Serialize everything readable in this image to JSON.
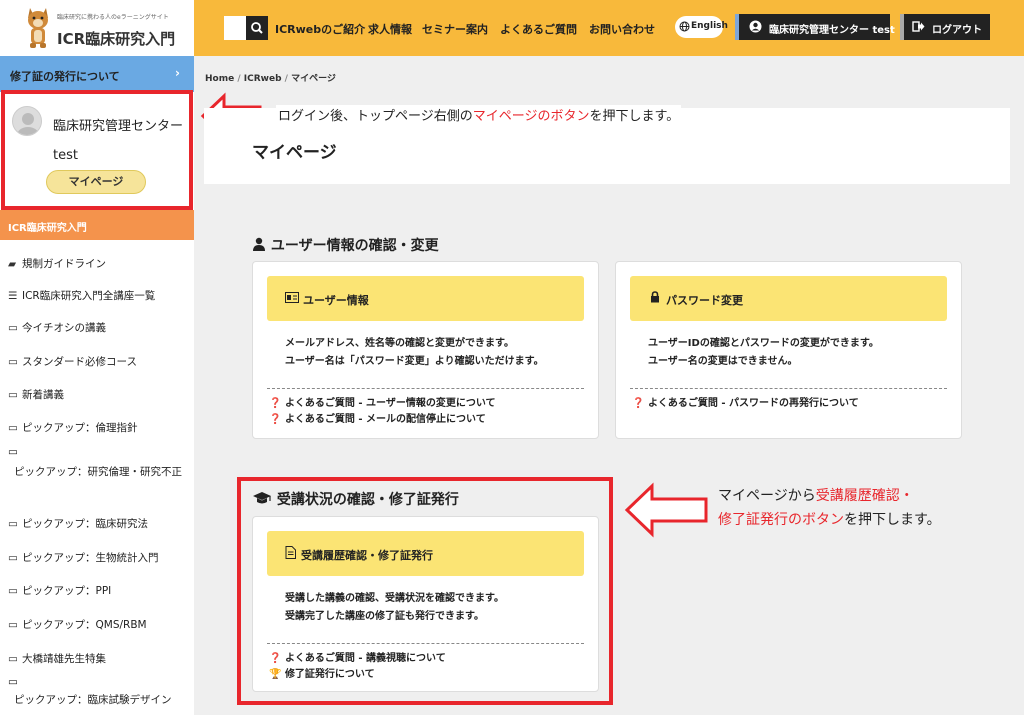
{
  "logo": {
    "subtitle": "臨床研究に携わる人のeラーニングサイト",
    "title": "ICR臨床研究入門"
  },
  "nav": {
    "links": [
      "ICRwebのご紹介",
      "求人情報",
      "セミナー案内",
      "よくあるご質問",
      "お問い合わせ"
    ],
    "language": "English",
    "user_label": "臨床研究管理センター test",
    "logout_label": "ログアウト"
  },
  "sidebar": {
    "top_item": "修了証の発行について",
    "user_name": "臨床研究管理センター test",
    "mypage_button": "マイページ",
    "section_header": "ICR臨床研究入門",
    "items": [
      {
        "icon": "book-icon",
        "glyph": "📘",
        "label": "規制ガイドライン"
      },
      {
        "icon": "list-icon",
        "glyph": "☰",
        "label": "ICR臨床研究入門全講座一覧"
      },
      {
        "icon": "folder-icon",
        "glyph": "🗀",
        "label": "今イチオシの講義"
      },
      {
        "icon": "folder-icon",
        "glyph": "🗀",
        "label": "スタンダード必修コース"
      },
      {
        "icon": "folder-icon",
        "glyph": "🗀",
        "label": "新着講義"
      },
      {
        "icon": "folder-icon",
        "glyph": "🗀",
        "label": "ピックアップ：倫理指針"
      },
      {
        "icon": "folder-icon",
        "glyph": "🗀",
        "label": "ピックアップ：研究倫理・研究不正"
      },
      {
        "icon": "folder-icon",
        "glyph": "🗀",
        "label": "ピックアップ：臨床研究法"
      },
      {
        "icon": "folder-icon",
        "glyph": "🗀",
        "label": "ピックアップ：生物統計入門"
      },
      {
        "icon": "folder-icon",
        "glyph": "🗀",
        "label": "ピックアップ：PPI"
      },
      {
        "icon": "folder-icon",
        "glyph": "🗀",
        "label": "ピックアップ：QMS/RBM"
      },
      {
        "icon": "folder-icon",
        "glyph": "🗀",
        "label": "大橋靖雄先生特集"
      },
      {
        "icon": "folder-icon",
        "glyph": "🗀",
        "label": "ピックアップ：臨床試験デザイン"
      }
    ]
  },
  "breadcrumb": [
    "Home",
    "ICRweb",
    "マイページ"
  ],
  "page_title": "マイページ",
  "annotation1": {
    "before": "ログイン後、トップページ右側の",
    "highlight": "マイページのボタン",
    "after": "を押下します。"
  },
  "section_user": {
    "heading": "ユーザー情報の確認・変更",
    "cards": [
      {
        "title": "ユーザー情報",
        "desc": [
          "メールアドレス、姓名等の確認と変更ができます。",
          "ユーザー名は「パスワード変更」より確認いただけます。"
        ],
        "faq": [
          "よくあるご質問 - ユーザー情報の変更について",
          "よくあるご質問 - メールの配信停止について"
        ]
      },
      {
        "title": "パスワード変更",
        "desc": [
          "ユーザーIDの確認とパスワードの変更ができます。",
          "ユーザー名の変更はできません。"
        ],
        "faq": [
          "よくあるご質問 - パスワードの再発行について"
        ]
      }
    ]
  },
  "section_course": {
    "heading": "受講状況の確認・修了証発行",
    "card": {
      "title": "受講履歴確認・修了証発行",
      "desc": [
        "受講した講義の確認、受講状況を確認できます。",
        "受講完了した講座の修了証も発行できます。"
      ],
      "faq": [
        "よくあるご質問 - 講義視聴について",
        "修了証発行について"
      ]
    }
  },
  "annotation2": {
    "line1_before": "マイページから",
    "line1_highlight": "受講履歴確認・",
    "line2_highlight": "修了証発行のボタン",
    "line2_after": "を押下します。"
  },
  "colors": {
    "header": "#f8b93b",
    "sidebar_top": "#6aa9e3",
    "sidebar_section": "#f4934c",
    "card_head": "#fbe474",
    "annotation_red": "#e8262c"
  }
}
